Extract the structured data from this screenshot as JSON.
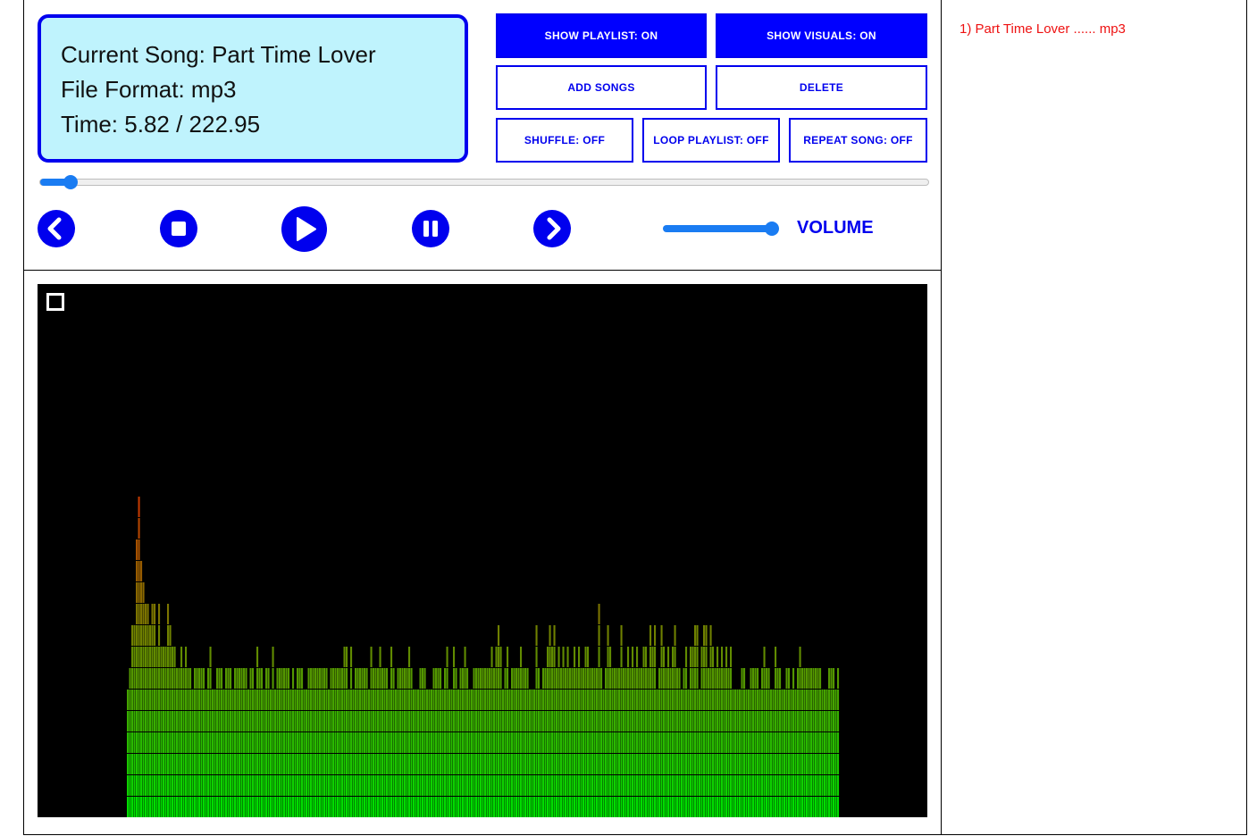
{
  "now_playing": {
    "song_line": "Current Song: Part Time Lover",
    "format_line": "File Format: mp3",
    "time_line": "Time: 5.82 / 222.95",
    "current_time": 5.82,
    "duration": 222.95
  },
  "buttons": {
    "show_playlist": "SHOW PLAYLIST: ON",
    "show_visuals": "SHOW VISUALS: ON",
    "add_songs": "ADD SONGS",
    "delete": "DELETE",
    "shuffle": "SHUFFLE: OFF",
    "loop_playlist": "LOOP PLAYLIST: OFF",
    "repeat_song": "REPEAT SONG: OFF"
  },
  "transport": {
    "icons": [
      "previous-icon",
      "stop-icon",
      "play-icon",
      "pause-icon",
      "next-icon"
    ]
  },
  "volume": {
    "label": "VOLUME",
    "level": 1.0
  },
  "playlist": {
    "items": [
      "1) Part Time Lover ...... mp3"
    ]
  },
  "colors": {
    "accent": "#0000ee",
    "button_on": "#0000ff",
    "info_bg": "#bff3fd",
    "playlist_text": "#ee1111",
    "slider": "#1a7cf2",
    "spectrum_low": "#00dd00",
    "spectrum_high": "#dd2200"
  }
}
